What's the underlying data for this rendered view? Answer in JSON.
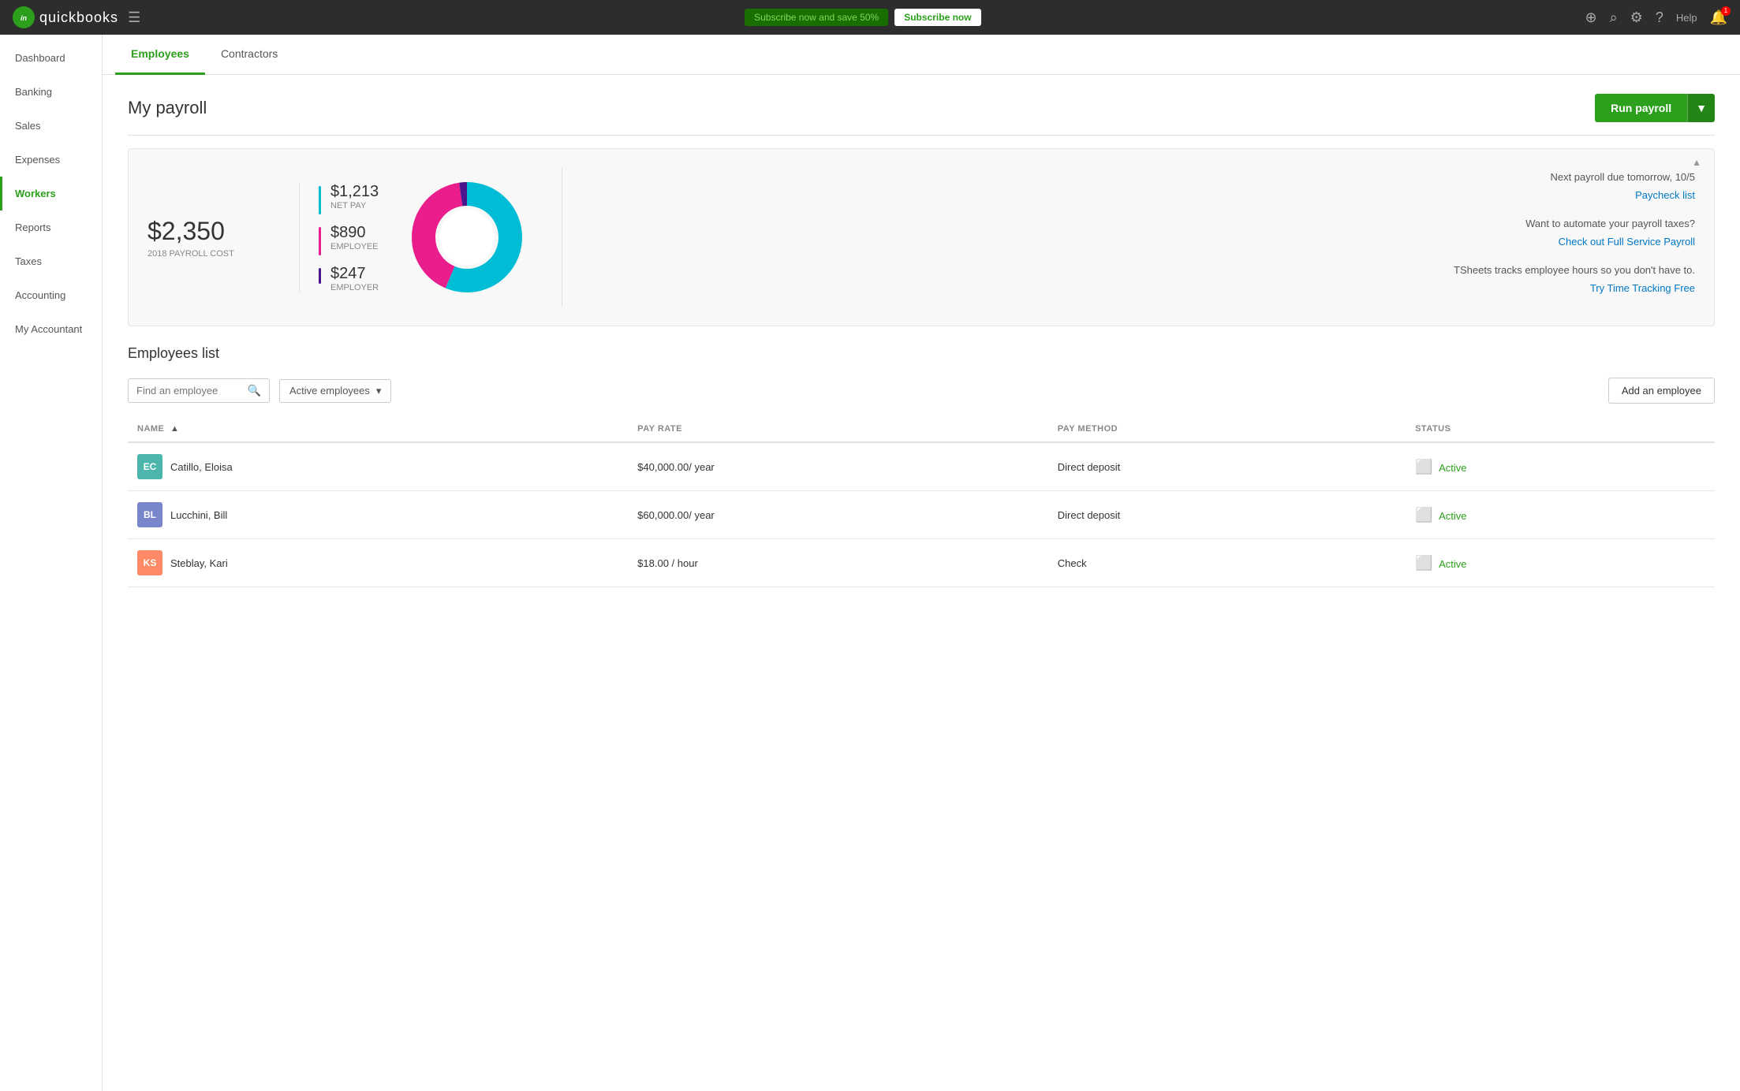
{
  "topbar": {
    "logo_text": "quickbooks",
    "logo_abbr": "in",
    "subscribe_text": "Subscribe now and save 50%",
    "subscribe_btn": "Subscribe now",
    "help_text": "Help",
    "notif_count": "1"
  },
  "sidebar": {
    "items": [
      {
        "id": "dashboard",
        "label": "Dashboard",
        "active": false
      },
      {
        "id": "banking",
        "label": "Banking",
        "active": false
      },
      {
        "id": "sales",
        "label": "Sales",
        "active": false
      },
      {
        "id": "expenses",
        "label": "Expenses",
        "active": false
      },
      {
        "id": "workers",
        "label": "Workers",
        "active": true
      },
      {
        "id": "reports",
        "label": "Reports",
        "active": false
      },
      {
        "id": "taxes",
        "label": "Taxes",
        "active": false
      },
      {
        "id": "accounting",
        "label": "Accounting",
        "active": false
      },
      {
        "id": "my-accountant",
        "label": "My Accountant",
        "active": false
      }
    ]
  },
  "tabs": [
    {
      "id": "employees",
      "label": "Employees",
      "active": true
    },
    {
      "id": "contractors",
      "label": "Contractors",
      "active": false
    }
  ],
  "page": {
    "title": "My payroll",
    "run_payroll_btn": "Run payroll"
  },
  "payroll_summary": {
    "cost_amount": "$2,350",
    "cost_label": "2018 PAYROLL COST",
    "breakdown": [
      {
        "id": "net",
        "amount": "$1,213",
        "label": "NET PAY",
        "color": "#00bcd4"
      },
      {
        "id": "employee",
        "amount": "$890",
        "label": "EMPLOYEE",
        "color": "#e91e8c"
      },
      {
        "id": "employer",
        "amount": "$247",
        "label": "EMPLOYER",
        "color": "#4a148c"
      }
    ],
    "chart": {
      "net_pct": 51.6,
      "employee_pct": 37.9,
      "employer_pct": 10.5
    },
    "next_payroll": "Next payroll due tomorrow, 10/5",
    "paycheck_list_link": "Paycheck list",
    "automate_text": "Want to automate your payroll taxes?",
    "full_service_link": "Check out Full Service Payroll",
    "tsheets_text": "TSheets tracks employee hours so you don't have to.",
    "time_tracking_link": "Try Time Tracking Free"
  },
  "employees_list": {
    "section_title": "Employees list",
    "search_placeholder": "Find an employee",
    "filter_label": "Active employees",
    "add_btn": "Add an employee",
    "columns": {
      "name": "NAME",
      "pay_rate": "PAY RATE",
      "pay_method": "PAY METHOD",
      "status": "STATUS"
    },
    "employees": [
      {
        "id": "ec",
        "initials": "EC",
        "name": "Catillo, Eloisa",
        "pay_rate": "$40,000.00/ year",
        "pay_method": "Direct deposit",
        "status": "Active",
        "avatar_class": "avatar-ec"
      },
      {
        "id": "bl",
        "initials": "BL",
        "name": "Lucchini, Bill",
        "pay_rate": "$60,000.00/ year",
        "pay_method": "Direct deposit",
        "status": "Active",
        "avatar_class": "avatar-bl"
      },
      {
        "id": "ks",
        "initials": "KS",
        "name": "Steblay, Kari",
        "pay_rate": "$18.00 / hour",
        "pay_method": "Check",
        "status": "Active",
        "avatar_class": "avatar-ks"
      }
    ]
  }
}
